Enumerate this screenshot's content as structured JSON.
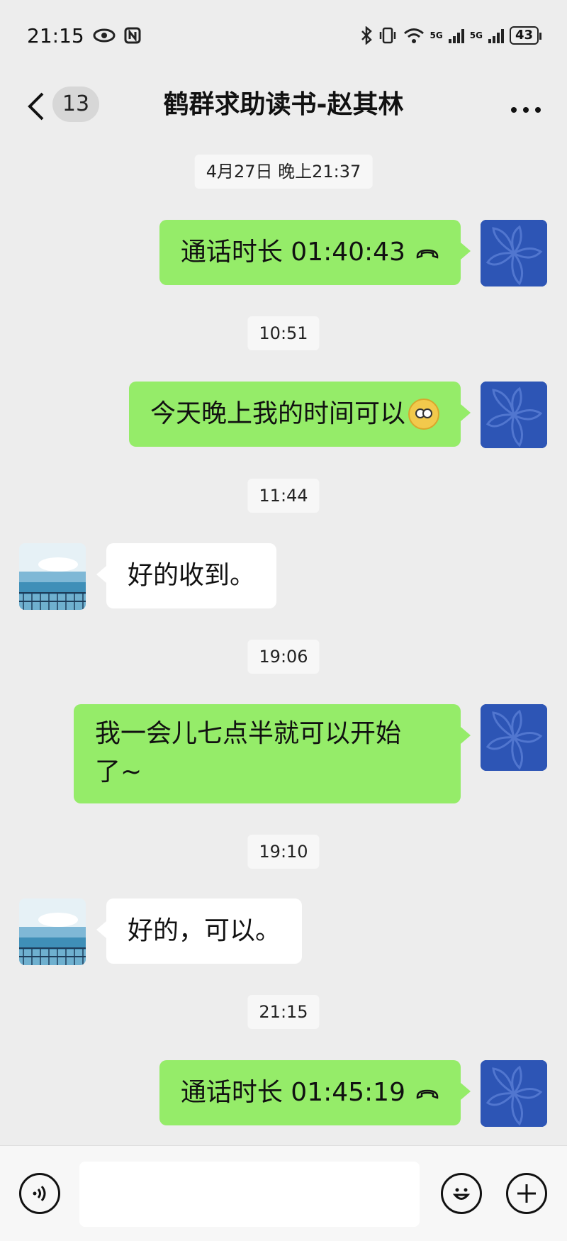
{
  "status_bar": {
    "time": "21:15",
    "battery": "43",
    "network_label": "5G"
  },
  "header": {
    "unread_count": "13",
    "title": "鹤群求助读书-赵其林",
    "more": "···"
  },
  "messages": [
    {
      "type": "timestamp",
      "text": "4月27日 晚上21:37"
    },
    {
      "type": "call",
      "from": "me",
      "text": "通话时长 01:40:43"
    },
    {
      "type": "timestamp",
      "text": "10:51"
    },
    {
      "type": "text",
      "from": "me",
      "text": "今天晚上我的时间可以",
      "emoji": "thinking-face-emoji"
    },
    {
      "type": "timestamp",
      "text": "11:44"
    },
    {
      "type": "text",
      "from": "other",
      "text": "好的收到。"
    },
    {
      "type": "timestamp",
      "text": "19:06"
    },
    {
      "type": "text",
      "from": "me",
      "line1": "我一会儿七点半就可以开始",
      "line2": "了~"
    },
    {
      "type": "timestamp",
      "text": "19:10"
    },
    {
      "type": "text",
      "from": "other",
      "text": "好的，可以。"
    },
    {
      "type": "timestamp",
      "text": "21:15"
    },
    {
      "type": "call",
      "from": "me",
      "text": "通话时长 01:45:19"
    }
  ],
  "colors": {
    "my_bubble": "#95ec69",
    "other_bubble": "#ffffff",
    "background": "#ededed",
    "my_avatar": "#2d55b5"
  },
  "icons": {
    "back": "chevron-left-icon",
    "more": "more-horizontal-icon",
    "call": "phone-hangup-icon",
    "voice": "voice-input-icon",
    "emoji": "emoji-icon",
    "plus": "plus-icon"
  }
}
